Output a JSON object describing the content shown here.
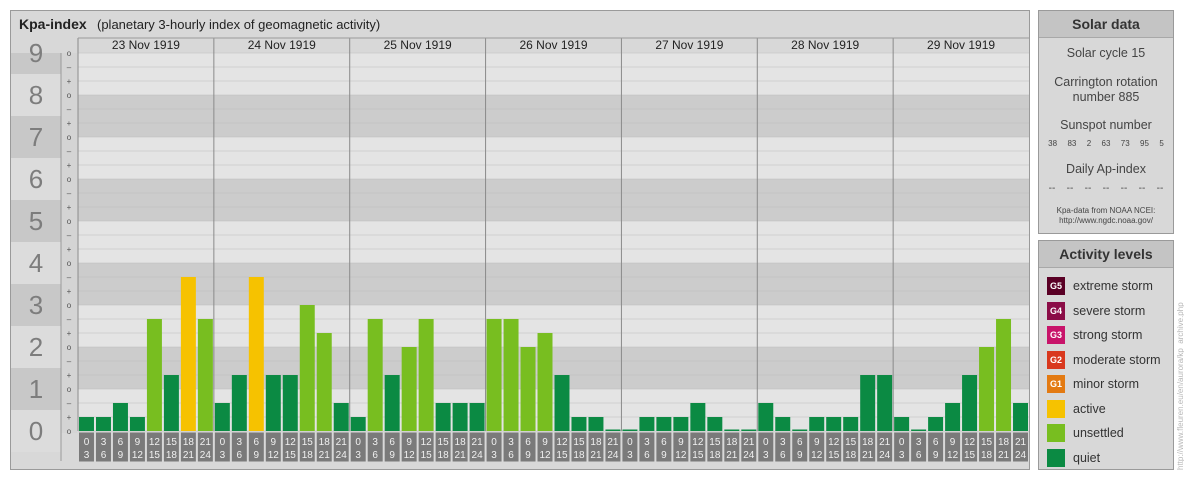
{
  "header": {
    "title": "Kpa-index",
    "subtitle": "(planetary 3-hourly index of geomagnetic activity)"
  },
  "chart_data": {
    "type": "bar",
    "ylim": [
      0,
      9
    ],
    "y_ticks": [
      "0",
      "1",
      "2",
      "3",
      "4",
      "5",
      "6",
      "7",
      "8",
      "9"
    ],
    "sub_ticks": [
      "+",
      "o",
      "–"
    ],
    "dates": [
      "23 Nov 1919",
      "24 Nov 1919",
      "25 Nov 1919",
      "26 Nov 1919",
      "27 Nov 1919",
      "28 Nov 1919",
      "29 Nov 1919"
    ],
    "hour_ranges": [
      [
        "0",
        "3"
      ],
      [
        "3",
        "6"
      ],
      [
        "6",
        "9"
      ],
      [
        "9",
        "12"
      ],
      [
        "12",
        "15"
      ],
      [
        "15",
        "18"
      ],
      [
        "18",
        "21"
      ],
      [
        "21",
        "24"
      ]
    ],
    "values": [
      0.333,
      0.333,
      0.667,
      0.333,
      2.667,
      1.333,
      3.667,
      2.667,
      0.667,
      1.333,
      3.667,
      1.333,
      1.333,
      3.0,
      2.333,
      0.667,
      0.333,
      2.667,
      1.333,
      2.0,
      2.667,
      0.667,
      0.667,
      0.667,
      2.667,
      2.667,
      2.0,
      2.333,
      1.333,
      0.333,
      0.333,
      0.0,
      0.0,
      0.333,
      0.333,
      0.333,
      0.667,
      0.333,
      0.0,
      0.0,
      0.667,
      0.333,
      0.0,
      0.333,
      0.333,
      0.333,
      1.333,
      1.333,
      0.333,
      0.0,
      0.333,
      0.667,
      1.333,
      2.0,
      2.667,
      0.667
    ],
    "colors": {
      "quiet": "#0b8a43",
      "unsettled": "#78be20",
      "active": "#f6c200",
      "G1": "#e37a12",
      "G2": "#d9381e",
      "G3": "#c8146a",
      "G4": "#8b0d47",
      "G5": "#5a0025"
    },
    "grid": true
  },
  "solar": {
    "title": "Solar data",
    "cycle": "Solar cycle 15",
    "carrington": "Carrington rotation number 885",
    "sunspot_title": "Sunspot number",
    "sunspot_values": [
      "38",
      "83",
      "2",
      "63",
      "73",
      "95",
      "5"
    ],
    "ap_title": "Daily Ap-index",
    "ap_values": [
      "--",
      "--",
      "--",
      "--",
      "--",
      "--",
      "--"
    ],
    "source_line1": "Kpa-data from NOAA NCEI:",
    "source_line2": "http://www.ngdc.noaa.gov/"
  },
  "activity": {
    "title": "Activity levels",
    "items": [
      {
        "code": "G5",
        "label": "extreme storm",
        "color": "#5a0025"
      },
      {
        "code": "G4",
        "label": "severe storm",
        "color": "#8b0d47"
      },
      {
        "code": "G3",
        "label": "strong storm",
        "color": "#c8146a"
      },
      {
        "code": "G2",
        "label": "moderate storm",
        "color": "#d9381e"
      },
      {
        "code": "G1",
        "label": "minor storm",
        "color": "#e37a12"
      },
      {
        "code": "",
        "label": "active",
        "color": "#f6c200"
      },
      {
        "code": "",
        "label": "unsettled",
        "color": "#78be20"
      },
      {
        "code": "",
        "label": "quiet",
        "color": "#0b8a43"
      }
    ]
  },
  "watermark": "http://www.fleuren.eu/en/aurora/kp_archive.php"
}
